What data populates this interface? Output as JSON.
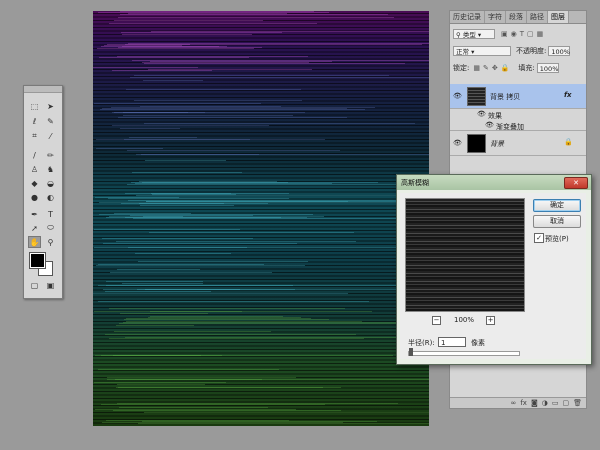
{
  "colors": {
    "canvas_top": "#4a0b55",
    "canvas_mid": "#0f4a55",
    "canvas_bottom": "#1a3a10",
    "selected_layer": "#a9c3ec"
  },
  "panel": {
    "tabs": [
      "历史记录",
      "字符",
      "段落",
      "路径",
      "图层"
    ],
    "active_tab": "图层",
    "filter_label": "类型",
    "blend_mode": "正常",
    "opacity_label": "不透明度:",
    "opacity_value": "100%",
    "lock_label": "锁定:",
    "fill_label": "填充:",
    "fill_value": "100%",
    "layers": [
      {
        "name": "背景 拷贝",
        "fx": "fx",
        "selected": true
      },
      {
        "name": "效果",
        "sub": true
      },
      {
        "name": "渐变叠加",
        "sub": true
      },
      {
        "name": "背景",
        "locked": true
      }
    ]
  },
  "dialog": {
    "title": "高斯模糊",
    "close": "✕",
    "ok_label": "确定",
    "cancel_label": "取消",
    "preview_label": "预览(P)",
    "preview_checked": true,
    "zoom_value": "100%",
    "radius_label": "半径(R):",
    "radius_value": "1",
    "radius_unit": "像素"
  },
  "toolbox": {
    "tools": [
      "marquee-tool",
      "move-tool",
      "lasso-tool",
      "quick-select-tool",
      "crop-tool",
      "eyedropper-tool",
      "brush-tool",
      "pencil-tool",
      "stamp-tool",
      "history-brush-tool",
      "eraser-tool",
      "paint-bucket-tool",
      "blur-tool",
      "dodge-tool",
      "pen-tool",
      "type-tool",
      "path-select-tool",
      "ellipse-tool",
      "hand-tool",
      "zoom-tool"
    ]
  }
}
